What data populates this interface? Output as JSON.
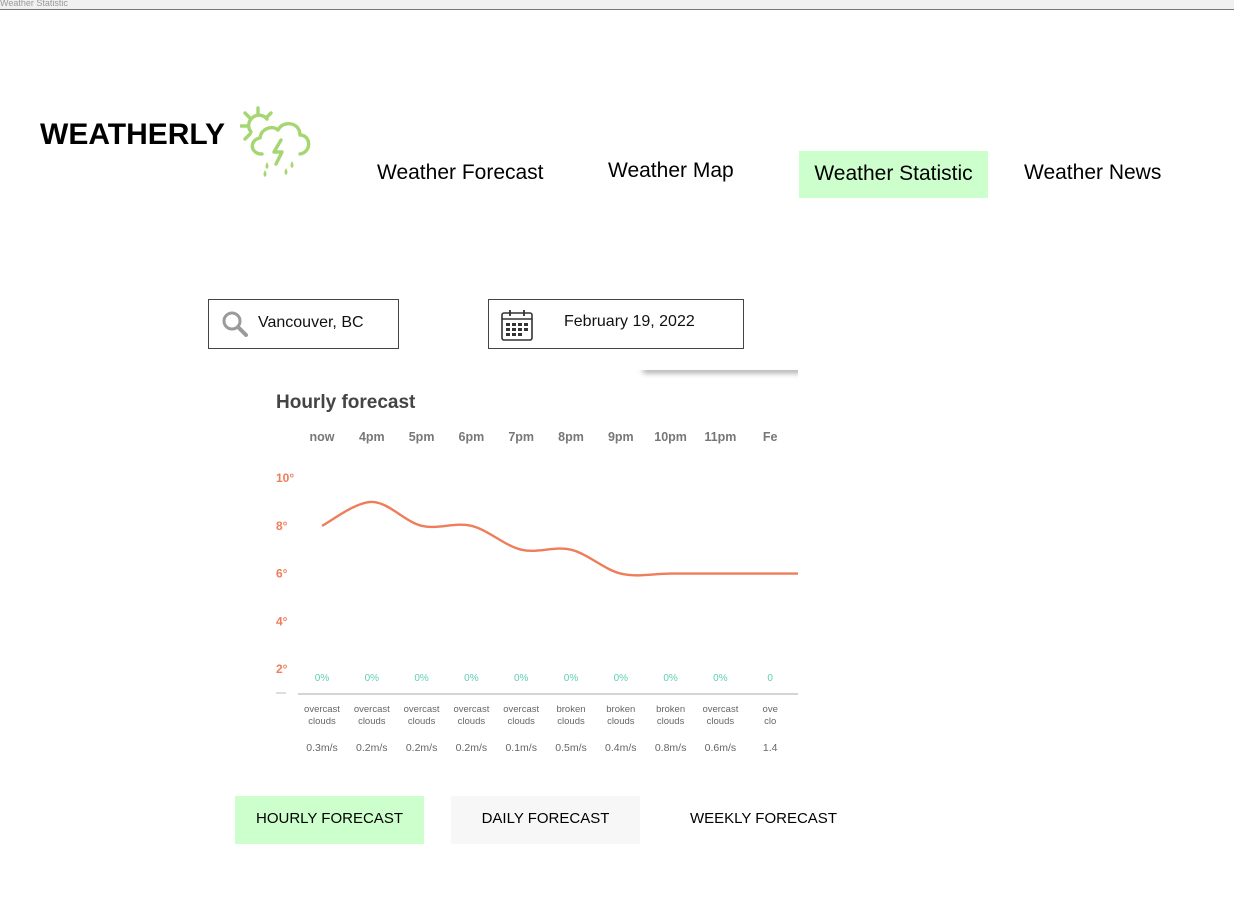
{
  "window": {
    "title": "Weather Statistic"
  },
  "brand": {
    "name": "WEATHERLY",
    "logo_icon": "sun-cloud-storm-icon",
    "logo_color": "#a6d672"
  },
  "nav": {
    "items": [
      {
        "label": "Weather Forecast",
        "active": false
      },
      {
        "label": "Weather Map",
        "active": false
      },
      {
        "label": "Weather Statistic",
        "active": true
      },
      {
        "label": "Weather News",
        "active": false
      }
    ],
    "active_color": "#ccffcc"
  },
  "search": {
    "value": "Vancouver, BC",
    "icon": "search-icon"
  },
  "date_picker": {
    "value": "February 19, 2022",
    "icon": "calendar-icon"
  },
  "forecast": {
    "title": "Hourly forecast",
    "precipitation": [
      "0%",
      "0%",
      "0%",
      "0%",
      "0%",
      "0%",
      "0%",
      "0%",
      "0%",
      "0"
    ],
    "conditions": [
      [
        "overcast",
        "clouds"
      ],
      [
        "overcast",
        "clouds"
      ],
      [
        "overcast",
        "clouds"
      ],
      [
        "overcast",
        "clouds"
      ],
      [
        "overcast",
        "clouds"
      ],
      [
        "broken",
        "clouds"
      ],
      [
        "broken",
        "clouds"
      ],
      [
        "broken",
        "clouds"
      ],
      [
        "overcast",
        "clouds"
      ],
      [
        "ove",
        "clo"
      ]
    ],
    "wind": [
      "0.3m/s",
      "0.2m/s",
      "0.2m/s",
      "0.2m/s",
      "0.1m/s",
      "0.5m/s",
      "0.4m/s",
      "0.8m/s",
      "0.6m/s",
      "1.4"
    ]
  },
  "chart_data": {
    "type": "line",
    "title": "Hourly forecast",
    "categories": [
      "now",
      "4pm",
      "5pm",
      "6pm",
      "7pm",
      "8pm",
      "9pm",
      "10pm",
      "11pm",
      "Fe"
    ],
    "series": [
      {
        "values": [
          8,
          9,
          8,
          8,
          7,
          7,
          6,
          6,
          6,
          6
        ]
      }
    ],
    "ytick_labels": [
      "10°",
      "8°",
      "6°",
      "4°",
      "2°"
    ],
    "yticks": [
      10,
      8,
      6,
      4,
      2
    ],
    "ylim": [
      1,
      10
    ],
    "grid": false,
    "line_color": "#ee7d5a",
    "precip_color": "#5fcfb5",
    "tick_color": "#ee7d5a"
  },
  "tabs": [
    {
      "label": "HOURLY FORECAST",
      "active": true
    },
    {
      "label": "DAILY FORECAST",
      "active": false
    },
    {
      "label": "WEEKLY FORECAST",
      "active": false
    }
  ]
}
